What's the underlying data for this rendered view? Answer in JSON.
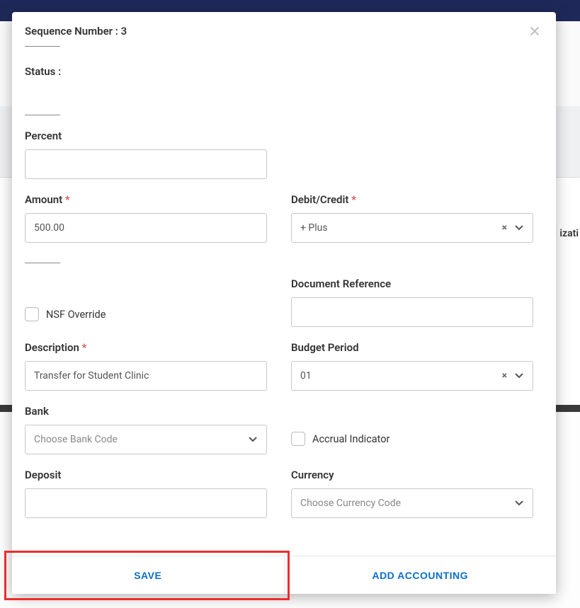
{
  "header": {
    "sequence_label": "Sequence Number : 3"
  },
  "background": {
    "partial_text": "izati"
  },
  "fields": {
    "status_label": "Status :",
    "percent_label": "Percent",
    "percent_value": "",
    "amount_label": "Amount",
    "amount_value": "500.00",
    "debit_credit_label": "Debit/Credit",
    "debit_credit_value": "+ Plus",
    "nsf_label": "NSF Override",
    "doc_ref_label": "Document Reference",
    "doc_ref_value": "",
    "description_label": "Description",
    "description_value": "Transfer for Student Clinic",
    "budget_period_label": "Budget Period",
    "budget_period_value": "01",
    "bank_label": "Bank",
    "bank_placeholder": "Choose Bank Code",
    "accrual_label": "Accrual Indicator",
    "deposit_label": "Deposit",
    "deposit_value": "",
    "currency_label": "Currency",
    "currency_placeholder": "Choose Currency Code"
  },
  "footer": {
    "save": "SAVE",
    "add_accounting": "ADD ACCOUNTING"
  },
  "icons": {
    "clear": "×"
  }
}
